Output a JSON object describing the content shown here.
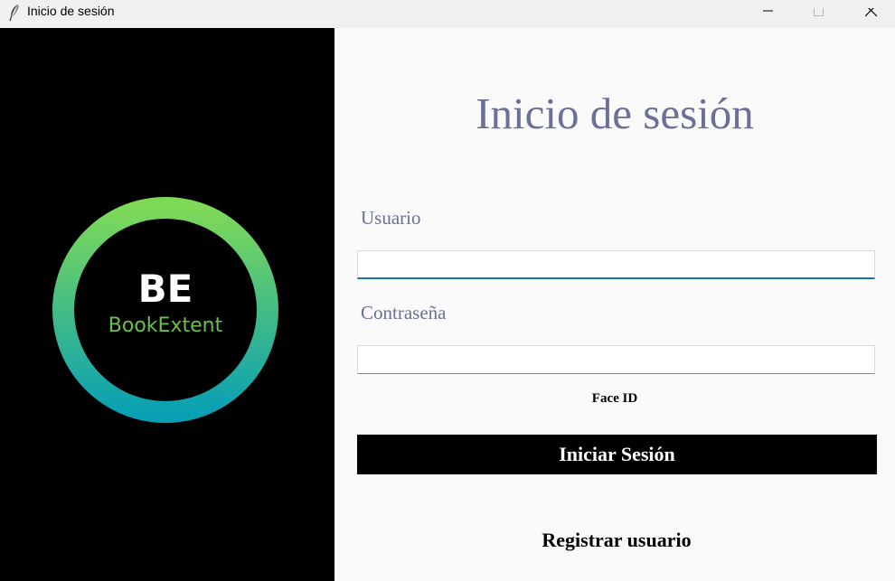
{
  "window": {
    "title": "Inicio de sesión",
    "app_icon": "feather-icon",
    "controls": [
      "minimize-icon",
      "maximize-icon",
      "close-icon"
    ]
  },
  "logo": {
    "initials": "BE",
    "name": "BookExtent",
    "ring_gradient": [
      "#7ed957",
      "#0aa0b4"
    ],
    "name_color": "#6cc04a"
  },
  "form": {
    "title": "Inicio de sesión",
    "username_label": "Usuario",
    "username_value": "",
    "password_label": "Contraseña",
    "password_value": "",
    "face_id_label": "Face ID",
    "login_button": "Iniciar Sesión",
    "register_link": "Registrar usuario"
  },
  "colors": {
    "label_color": "#6b7099",
    "focus_underline": "#1f6fc0",
    "button_bg": "#000000"
  }
}
